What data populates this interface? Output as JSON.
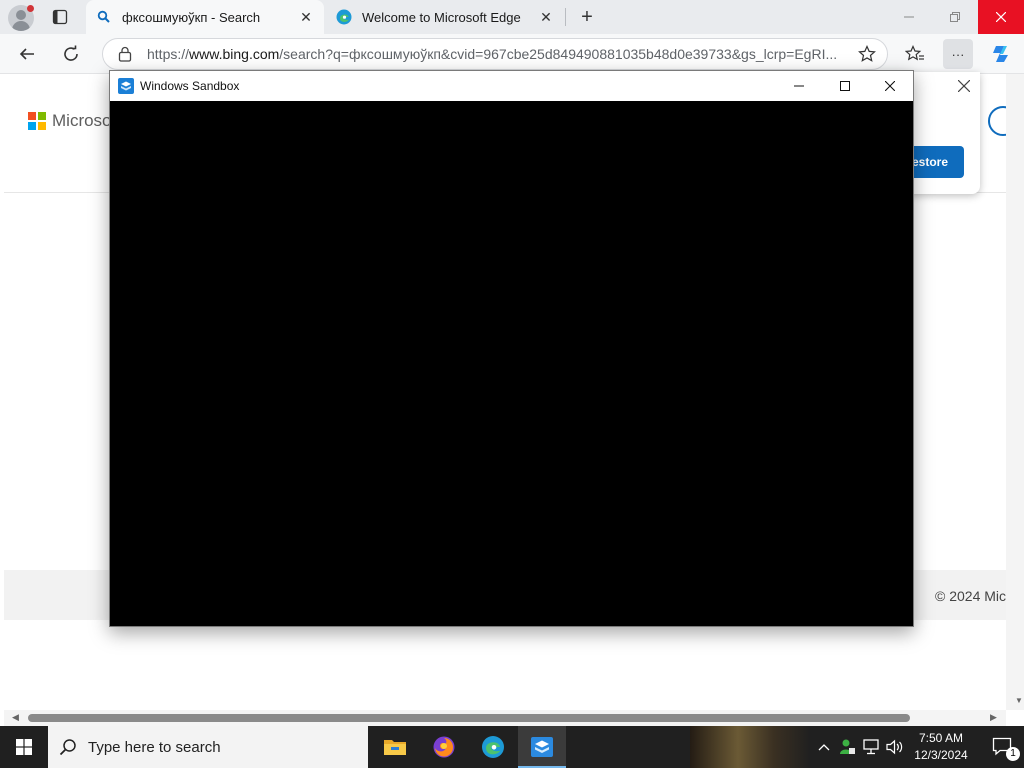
{
  "browser": {
    "tabs": [
      {
        "title": "фксошмуюўкп - Search",
        "active": true,
        "icon": "search-icon"
      },
      {
        "title": "Welcome to Microsoft Edge",
        "active": false,
        "icon": "edge-icon"
      }
    ],
    "close_glyph": "✕",
    "new_tab_glyph": "+",
    "address": {
      "prefix": "https://",
      "domain": "www.bing.com",
      "rest": "/search?q=фксошмуюўкп&cvid=967cbe25d849490881035b48d0e39733&gs_lcrp=EgRI..."
    },
    "more_glyph": "···"
  },
  "page": {
    "logo_text": "Microsoft",
    "restore_button": "estore",
    "copyright": "© 2024 Mic"
  },
  "sandbox": {
    "title": "Windows Sandbox"
  },
  "taskbar": {
    "search_placeholder": "Type here to search",
    "time": "7:50 AM",
    "date": "12/3/2024",
    "notification_count": "1",
    "apps": [
      "file-explorer-icon",
      "firefox-icon",
      "edge-icon",
      "windows-sandbox-icon"
    ]
  },
  "colors": {
    "accent": "#0f6cbd",
    "close_red": "#e81123",
    "taskbar": "#202020"
  }
}
